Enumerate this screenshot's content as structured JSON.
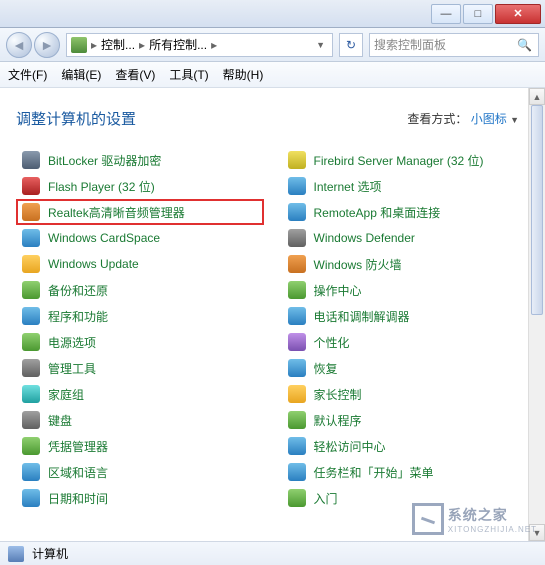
{
  "title_buttons": {
    "min": "—",
    "max": "□",
    "close": "✕"
  },
  "breadcrumb": {
    "part1": "控制...",
    "part2": "所有控制..."
  },
  "search_placeholder": "搜索控制面板",
  "menubar": [
    "文件(F)",
    "编辑(E)",
    "查看(V)",
    "工具(T)",
    "帮助(H)"
  ],
  "heading": "调整计算机的设置",
  "viewmode": {
    "label": "查看方式：",
    "value": "小图标"
  },
  "left_items": [
    {
      "label": "BitLocker 驱动器加密",
      "c": "c1"
    },
    {
      "label": "Flash Player (32 位)",
      "c": "c2"
    },
    {
      "label": "Realtek高清晰音频管理器",
      "c": "c3",
      "hl": true
    },
    {
      "label": "Windows CardSpace",
      "c": "c4"
    },
    {
      "label": "Windows Update",
      "c": "c5"
    },
    {
      "label": "备份和还原",
      "c": "c6"
    },
    {
      "label": "程序和功能",
      "c": "c4"
    },
    {
      "label": "电源选项",
      "c": "c6"
    },
    {
      "label": "管理工具",
      "c": "c8"
    },
    {
      "label": "家庭组",
      "c": "c9"
    },
    {
      "label": "键盘",
      "c": "c8"
    },
    {
      "label": "凭据管理器",
      "c": "c6"
    },
    {
      "label": "区域和语言",
      "c": "c4"
    },
    {
      "label": "日期和时间",
      "c": "c4"
    }
  ],
  "right_items": [
    {
      "label": "Firebird Server Manager (32 位)",
      "c": "c10"
    },
    {
      "label": "Internet 选项",
      "c": "c4"
    },
    {
      "label": "RemoteApp 和桌面连接",
      "c": "c4"
    },
    {
      "label": "Windows Defender",
      "c": "c8"
    },
    {
      "label": "Windows 防火墙",
      "c": "c3"
    },
    {
      "label": "操作中心",
      "c": "c6"
    },
    {
      "label": "电话和调制解调器",
      "c": "c4"
    },
    {
      "label": "个性化",
      "c": "c7"
    },
    {
      "label": "恢复",
      "c": "c4"
    },
    {
      "label": "家长控制",
      "c": "c5"
    },
    {
      "label": "默认程序",
      "c": "c6"
    },
    {
      "label": "轻松访问中心",
      "c": "c4"
    },
    {
      "label": "任务栏和「开始」菜单",
      "c": "c4"
    },
    {
      "label": "入门",
      "c": "c6"
    }
  ],
  "statusbar": "计算机",
  "watermark": {
    "brand": "系统之家",
    "url": "XITONGZHIJIA.NET"
  }
}
